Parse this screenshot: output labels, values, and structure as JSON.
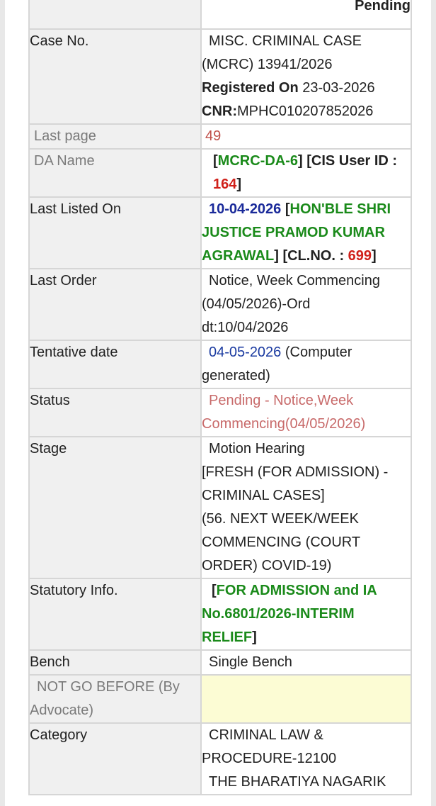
{
  "top_row": {
    "status_preview": "Pending"
  },
  "case_no": {
    "label": "Case No.",
    "line1": "MISC. CRIMINAL CASE",
    "line2": "(MCRC) 13941/2026",
    "registered_label": "Registered On",
    "registered_date": "23-03-2026",
    "cnr_label": "CNR:",
    "cnr_value": "MPHC010207852026"
  },
  "last_page": {
    "label": "Last page",
    "value": "49"
  },
  "da_name": {
    "label": "DA Name",
    "open1": "[",
    "da": "MCRC-DA-6",
    "close1": "]",
    "cis_label": "[CIS User ID :",
    "cis_id": "164",
    "close2": "]"
  },
  "last_listed": {
    "label": "Last Listed On",
    "date": "10-04-2026",
    "open1": "[",
    "judge": "HON'BLE SHRI JUSTICE PRAMOD KUMAR AGRAWAL",
    "close1": "]",
    "cl_label": "[CL.NO. :",
    "cl_no": "699",
    "close2": "]"
  },
  "last_order": {
    "label": "Last Order",
    "line1": "Notice, Week Commencing",
    "line2": "(04/05/2026)-Ord",
    "line3": "dt:10/04/2026"
  },
  "tentative": {
    "label": "Tentative date",
    "date": "04-05-2026",
    "note": "(Computer generated)"
  },
  "status": {
    "label": "Status",
    "line1": "Pending - Notice,Week",
    "line2": "Commencing(04/05/2026)"
  },
  "stage": {
    "label": "Stage",
    "line1": "Motion Hearing",
    "line2": "[FRESH (FOR ADMISSION) -",
    "line3": "CRIMINAL CASES]",
    "line4": "(56. NEXT WEEK/WEEK",
    "line5": "COMMENCING (COURT",
    "line6": "ORDER) COVID-19)"
  },
  "statutory": {
    "label": "Statutory Info.",
    "open1": "[",
    "text": "FOR ADMISSION and IA No.6801/2026-INTERIM RELIEF",
    "close1": "]"
  },
  "bench": {
    "label": "Bench",
    "value": "Single Bench"
  },
  "not_go_before": {
    "label": "NOT GO BEFORE (By Advocate)",
    "value": ""
  },
  "category": {
    "label": "Category",
    "line1": "CRIMINAL LAW &",
    "line2": "PROCEDURE-12100",
    "line3": "THE BHARATIYA NAGARIK"
  }
}
